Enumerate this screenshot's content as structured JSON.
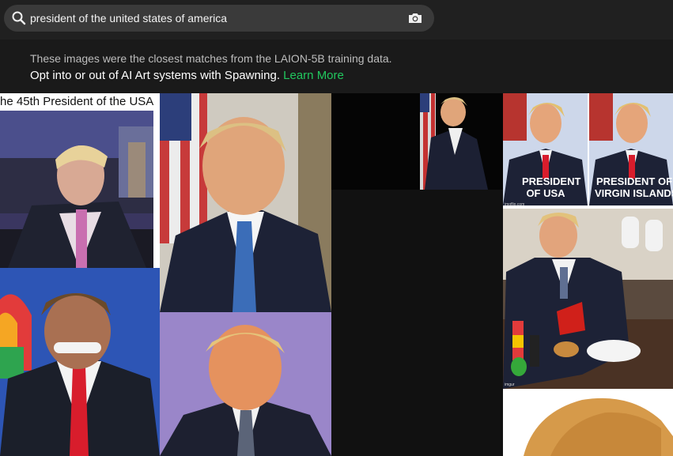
{
  "search": {
    "query": "president of the united states of america"
  },
  "notice": {
    "line1": "These images were the closest matches from the LAION-5B training data.",
    "line2": "Opt into or out of AI Art systems with Spawning.",
    "link": "Learn More"
  },
  "results": {
    "tile1_caption": "he 45th President of the USA",
    "tile5_left_caption_1": "PRESIDENT",
    "tile5_left_caption_2": "OF USA",
    "tile5_right_caption_1": "PRESIDENT OF",
    "tile5_right_caption_2": "VIRGIN ISLANDS",
    "tile5_watermark": "imgflip.com",
    "tile6_watermark": "imgur"
  },
  "colors": {
    "link_green": "#21c75e",
    "search_bg": "#3a3a3a",
    "topbar_bg": "#202020",
    "notice_bg": "#1a1a1a"
  },
  "icons": {
    "search": "magnifier",
    "camera": "camera"
  }
}
